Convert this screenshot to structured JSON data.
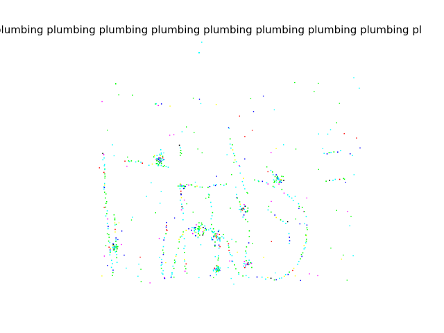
{
  "title": {
    "word": "plumbing",
    "repeat": 8,
    "trailing": "pl"
  },
  "colors": {
    "background": "#ffffff",
    "text": "#000000",
    "palette": [
      "#00ffff",
      "#00ff00",
      "#0000ff",
      "#ff00ff",
      "#ffff00",
      "#ff0000",
      "#000000"
    ]
  }
}
